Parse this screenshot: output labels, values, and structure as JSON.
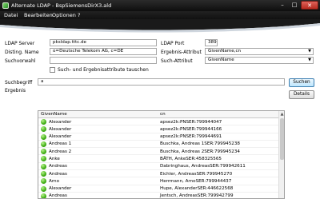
{
  "window": {
    "title": "Alternate LDAP - BspSiemensDirX3.ald",
    "minimize": "–",
    "maximize": "□",
    "close": "✕"
  },
  "menu": [
    "Datei",
    "Bearbeiten",
    "Optionen",
    "?"
  ],
  "form": {
    "ldap_server_label": "LDAP Server",
    "ldap_server_value": "pksldap.tttc.de",
    "disting_name_label": "Disting. Name",
    "disting_name_value": "o=Deutsche Telekom AG, c=DE",
    "suchvorwahl_label": "Suchvorwahl",
    "suchvorwahl_value": "",
    "ldap_port_label": "LDAP Port",
    "ldap_port_value": "389",
    "ergebnis_attribut_label": "Ergebnis-Attribut",
    "ergebnis_attribut_value": "GivenName,cn",
    "such_attribut_label": "Such-Attribut",
    "such_attribut_value": "GivenName",
    "swap_label": "Such- und Ergebnisattribute tauschen",
    "suchbegriff_label": "Suchbegriff",
    "suchbegriff_value": "a",
    "ergebnis_label": "Ergebnis",
    "suchen_button": "Suchen",
    "details_button": "Details"
  },
  "grid": {
    "columns": [
      "GivenName",
      "cn"
    ],
    "rows": [
      {
        "given_name": "Alexander",
        "cn": "apsez2k:PNSER:799944047"
      },
      {
        "given_name": "Alexander",
        "cn": "apsez2k:PNSER:799944166"
      },
      {
        "given_name": "Alexander",
        "cn": "apsez2k:PNSER:799944691"
      },
      {
        "given_name": "Andreas 1",
        "cn": "Buschka, Andreas 1SER:799945238"
      },
      {
        "given_name": "Andreas 2",
        "cn": "Buschka, Andreas 2SER:799945234"
      },
      {
        "given_name": "Anke",
        "cn": "BÄTH, AnkeSER:458325565"
      },
      {
        "given_name": "Andreas",
        "cn": "Dabringhaus, AndreasSER:799942611"
      },
      {
        "given_name": "Andreas",
        "cn": "Eichler, AndreasSER:799945270"
      },
      {
        "given_name": "Arno",
        "cn": "Herrmann, ArnoSER:799944437"
      },
      {
        "given_name": "Alexander",
        "cn": "Hupe, AlexanderSER:446622568"
      },
      {
        "given_name": "Andreas",
        "cn": "Jentsch, AndreasSER:799942799"
      }
    ]
  },
  "scrollbar": {
    "up": "▲",
    "down": "▼"
  },
  "icons": {
    "status": "green-status-icon",
    "dropdown": "chevron-down-icon"
  },
  "colors": {
    "titlebar": "#111111",
    "close": "#c8392d",
    "status_green": "#3fae12"
  }
}
